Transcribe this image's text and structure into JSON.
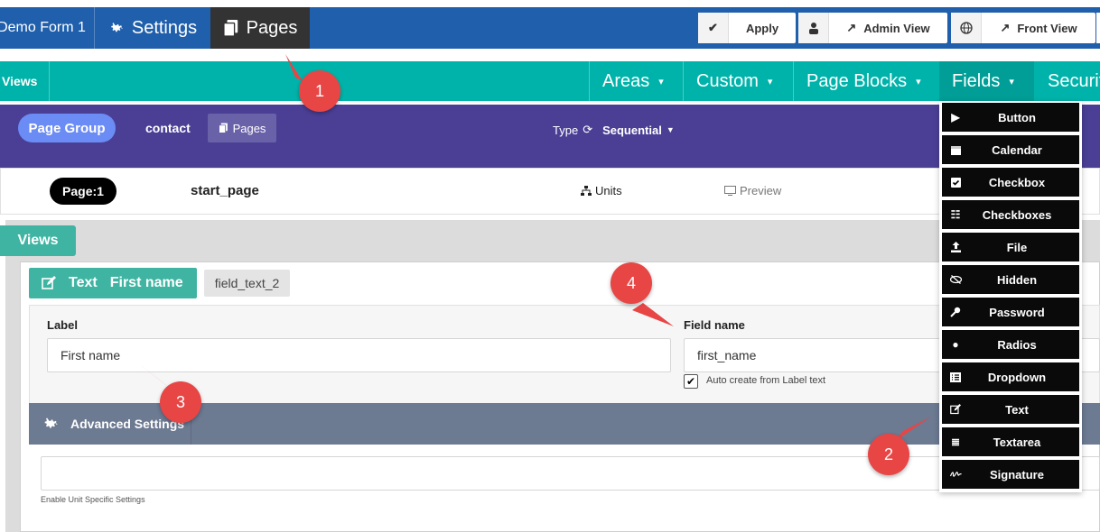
{
  "topbar": {
    "form_title": "Demo Form 1",
    "tabs": [
      {
        "label": "Settings",
        "icon": "gear-icon"
      },
      {
        "label": "Pages",
        "icon": "pages-icon"
      }
    ],
    "buttons": [
      {
        "label": "Apply",
        "icon": "check-icon"
      },
      {
        "label": "Admin View",
        "icon": "admin-icon"
      },
      {
        "label": "Front View",
        "icon": "globe-icon"
      }
    ]
  },
  "greenbar": {
    "left_label": "Views",
    "menus": [
      {
        "label": "Areas"
      },
      {
        "label": "Custom"
      },
      {
        "label": "Page Blocks"
      },
      {
        "label": "Fields"
      },
      {
        "label": "Securit"
      }
    ]
  },
  "purplebar": {
    "page_group": "Page Group",
    "contact": "contact",
    "pages_button": "Pages",
    "type_label": "Type",
    "type_value": "Sequential"
  },
  "pagerow": {
    "page_badge": "Page:1",
    "page_name": "start_page",
    "units": "Units",
    "preview": "Preview"
  },
  "views": {
    "tab_label": "Views",
    "field_type": "Text",
    "field_title": "First name",
    "field_id": "field_text_2",
    "label_caption": "Label",
    "label_value": "First name",
    "fieldname_caption": "Field name",
    "fieldname_value": "first_name",
    "autocreate_label": "Auto create from Label text",
    "advanced_label": "Advanced Settings",
    "unit_specific": "Enable Unit Specific Settings"
  },
  "fields_menu": [
    {
      "label": "Button",
      "icon": "play-icon"
    },
    {
      "label": "Calendar",
      "icon": "calendar-icon"
    },
    {
      "label": "Checkbox",
      "icon": "checkbox-icon"
    },
    {
      "label": "Checkboxes",
      "icon": "checklist-icon"
    },
    {
      "label": "File",
      "icon": "upload-icon"
    },
    {
      "label": "Hidden",
      "icon": "eye-slash-icon"
    },
    {
      "label": "Password",
      "icon": "key-icon"
    },
    {
      "label": "Radios",
      "icon": "circle-icon"
    },
    {
      "label": "Dropdown",
      "icon": "list-icon"
    },
    {
      "label": "Text",
      "icon": "edit-icon"
    },
    {
      "label": "Textarea",
      "icon": "lines-icon"
    },
    {
      "label": "Signature",
      "icon": "signature-icon"
    }
  ],
  "callouts": [
    "1",
    "2",
    "3",
    "4"
  ],
  "colors": {
    "topbar": "#1f5fac",
    "greenbar": "#00b3aa",
    "purplebar": "#4a3f95",
    "callout": "#e84545"
  }
}
